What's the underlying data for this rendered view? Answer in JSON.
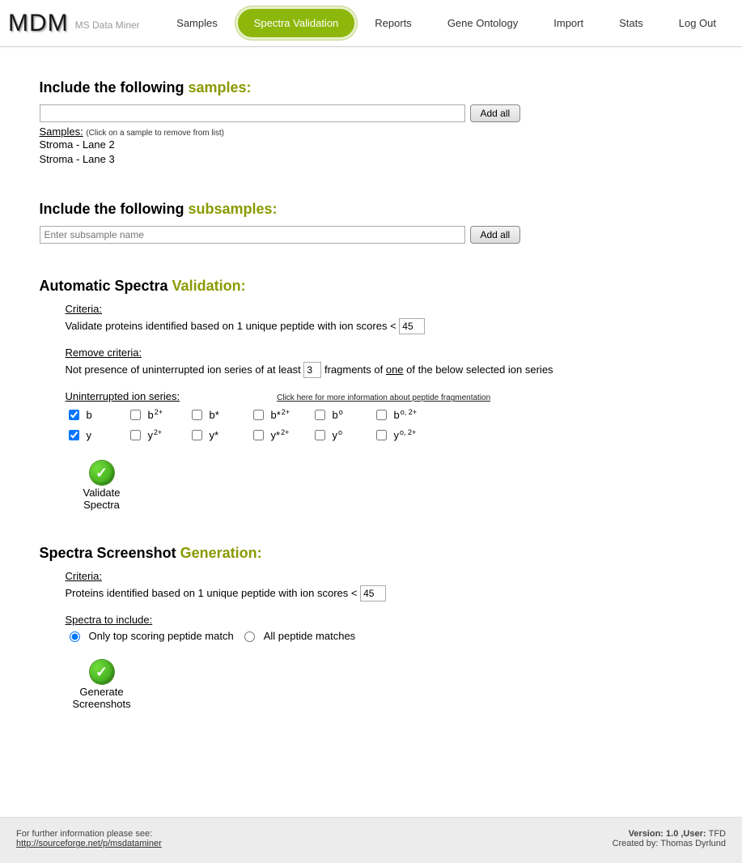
{
  "header": {
    "logo_main": "MDM",
    "subtitle": "MS Data Miner",
    "nav": [
      "Samples",
      "Spectra Validation",
      "Reports",
      "Gene Ontology",
      "Import",
      "Stats",
      "Log Out"
    ],
    "active_index": 1
  },
  "samples_section": {
    "heading_prefix": "Include the following ",
    "heading_accent": "samples:",
    "add_all": "Add all",
    "list_header": "Samples:",
    "list_hint": " (Click on a sample to remove from list)",
    "items": [
      "Stroma - Lane 2",
      "Stroma - Lane 3"
    ]
  },
  "subsamples_section": {
    "heading_prefix": "Include the following ",
    "heading_accent": "subsamples:",
    "placeholder": "Enter subsample name",
    "add_all": "Add all"
  },
  "validation_section": {
    "heading_prefix": "Automatic Spectra ",
    "heading_accent": "Validation:",
    "criteria_label": "Criteria:",
    "criteria_text": "Validate proteins identified based on 1 unique peptide with ion scores < ",
    "criteria_value": "45",
    "remove_label": "Remove criteria:",
    "remove_text_1": "Not presence of uninterrupted ion series of at least ",
    "remove_value": "3",
    "remove_text_2a": " fragments of ",
    "remove_text_2u": "one",
    "remove_text_2b": " of the below selected ion series",
    "ion_header": "Uninterrupted ion series:",
    "ion_link": "Click here for more information about peptide fragmentation",
    "ion_rows": [
      [
        {
          "label": "b",
          "checked": true
        },
        {
          "label": "b",
          "sup": "2+",
          "checked": false
        },
        {
          "label": "b*",
          "checked": false
        },
        {
          "label": "b*",
          "sup": "2+",
          "checked": false
        },
        {
          "label": "b",
          "sup": "o",
          "checked": false
        },
        {
          "label": "b",
          "sup": "o, 2+",
          "checked": false
        }
      ],
      [
        {
          "label": "y",
          "checked": true
        },
        {
          "label": "y",
          "sup": "2+",
          "checked": false
        },
        {
          "label": "y*",
          "checked": false
        },
        {
          "label": "y*",
          "sup": "2+",
          "checked": false
        },
        {
          "label": "y",
          "sup": "o",
          "checked": false
        },
        {
          "label": "y",
          "sup": "o, 2+",
          "checked": false
        }
      ]
    ],
    "validate_btn": "Validate Spectra"
  },
  "screenshot_section": {
    "heading_prefix": "Spectra Screenshot ",
    "heading_accent": "Generation:",
    "criteria_label": "Criteria:",
    "criteria_text": "Proteins identified based on 1 unique peptide with ion scores < ",
    "criteria_value": "45",
    "spectra_label": "Spectra to include:",
    "radio1": "Only top scoring peptide match",
    "radio2": "All peptide matches",
    "generate_btn": "Generate Screenshots"
  },
  "footer": {
    "info_text": "For further information please see:",
    "info_link": "http://sourceforge.net/p/msdataminer",
    "version_label": "Version: 1.0 ,User: ",
    "version_user": "TFD",
    "created": "Created by: Thomas Dyrlund"
  }
}
